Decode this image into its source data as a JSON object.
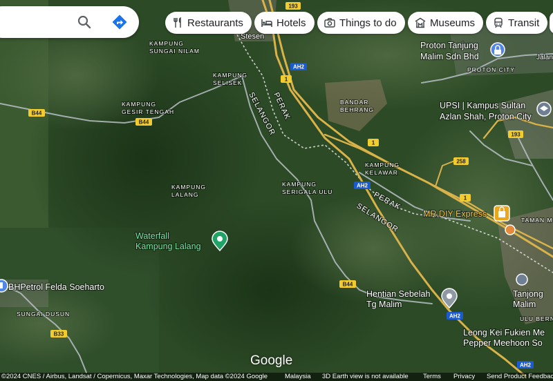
{
  "search": {
    "icon": "search-icon",
    "directions_icon": "directions-icon"
  },
  "chips": [
    {
      "label": "Restaurants",
      "icon": "restaurant-icon"
    },
    {
      "label": "Hotels",
      "icon": "hotel-icon"
    },
    {
      "label": "Things to do",
      "icon": "camera-icon"
    },
    {
      "label": "Museums",
      "icon": "museum-icon"
    },
    {
      "label": "Transit",
      "icon": "transit-icon"
    }
  ],
  "labels": {
    "stesen": "Stesen",
    "proton_company": "Proton Tanjung\nMalim Sdn Bhd",
    "proton_city": "PROTON CITY",
    "kg_sungai_nilam": "KAMPUNG\nSUNGAI NILAM",
    "kg_selisek": "KAMPUNG\nSELISEK",
    "kg_gesir_tengah": "KAMPUNG\nGESIR TENGAH",
    "bandar_behrang": "BANDAR\nBEHRANG",
    "upsi": "UPSI | Kampus Sultan\nAzlan Shah, Proton City",
    "kg_kelawar": "KAMPUNG\nKELAWAR",
    "kg_lalang": "KAMPUNG\nLALANG",
    "kg_serigala": "KAMPUNG\nSERIGALA ULU",
    "waterfall": "Waterfall\nKampung Lalang",
    "mrdiy": "MR.DIY Express",
    "taman": "TAMAN M",
    "bhpetrol": "BHPetrol Felda Soeharto",
    "sungai_dusun": "SUNGAI DUSUN",
    "hentian": "Hentian Sebelah\nTg Malim",
    "tanjong_malim": "Tanjong\nMalim",
    "ulu_bern": "ULU BERN",
    "leong": "Leong Kei Fukien Me\nPepper Meehoon So",
    "perak_1": "PERAK",
    "selangor_1": "SELANGOR",
    "perak_2": "PERAK",
    "selangor_2": "SELANGOR",
    "jalan": "Jalan"
  },
  "shields": {
    "r193a": "193",
    "ah2a": "AH2",
    "r1a": "1",
    "b44a": "B44",
    "b44b": "B44",
    "r1b": "1",
    "r258": "258",
    "ah2b": "AH2",
    "r1c": "1",
    "r193b": "193",
    "b44c": "B44",
    "b33": "B33",
    "ah2c": "AH2",
    "ah2d": "AH2"
  },
  "logo": "Google",
  "footer": {
    "attribution": "©2024 CNES / Airbus, Landsat / Copernicus, Maxar Technologies, Map data ©2024 Google",
    "country": "Malaysia",
    "earth_notice": "3D Earth view is not available",
    "terms": "Terms",
    "privacy": "Privacy",
    "feedback": "Send Product Feedback"
  },
  "colors": {
    "highway": "#d9b24a",
    "road": "#b9c0c6",
    "shield_blue": "#1a5ccf",
    "shield_yellow": "#f2cc2e",
    "pin_green": "#22a366",
    "pin_grey": "#8e99a4",
    "pin_shop": "#e9a81c"
  }
}
